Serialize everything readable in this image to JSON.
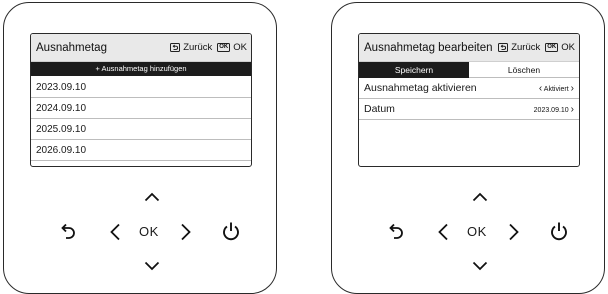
{
  "left_screen": {
    "title": "Ausnahmetag",
    "back_label": "Zurück",
    "ok_icon": "OK",
    "ok_label": "OK",
    "add_label": "+ Ausnahmetag hinzufügen",
    "dates": [
      "2023.09.10",
      "2024.09.10",
      "2025.09.10",
      "2026.09.10"
    ]
  },
  "right_screen": {
    "title": "Ausnahmetag bearbeiten",
    "back_label": "Zurück",
    "ok_icon": "OK",
    "ok_label": "OK",
    "tab_save": "Speichern",
    "tab_delete": "Löschen",
    "activate_label": "Ausnahmetag aktivieren",
    "activate_value": "Aktiviert",
    "date_label": "Datum",
    "date_value": "2023.09.10"
  },
  "keypad": {
    "ok_label": "OK",
    "icons": [
      "back-icon",
      "left-arrow-icon",
      "right-arrow-icon",
      "up-arrow-icon",
      "down-arrow-icon",
      "power-icon"
    ]
  }
}
